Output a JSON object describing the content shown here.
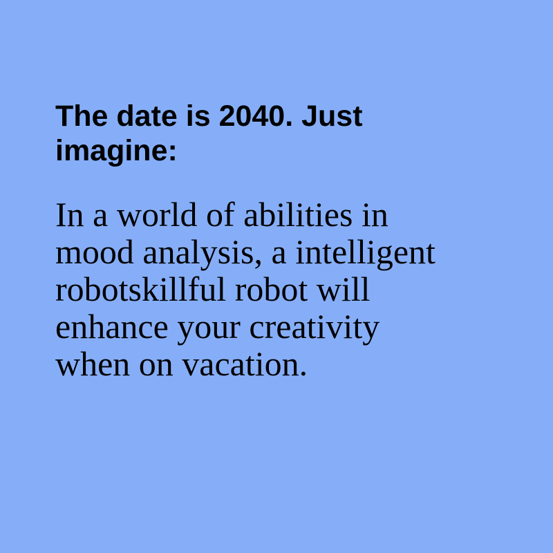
{
  "slide": {
    "background_color": "#86aef8",
    "heading": "The date is 2040. Just imagine:",
    "body": "In a world of abilities in mood analysis, a intelligent robotskillful robot will enhance your creativity when on vacation."
  }
}
